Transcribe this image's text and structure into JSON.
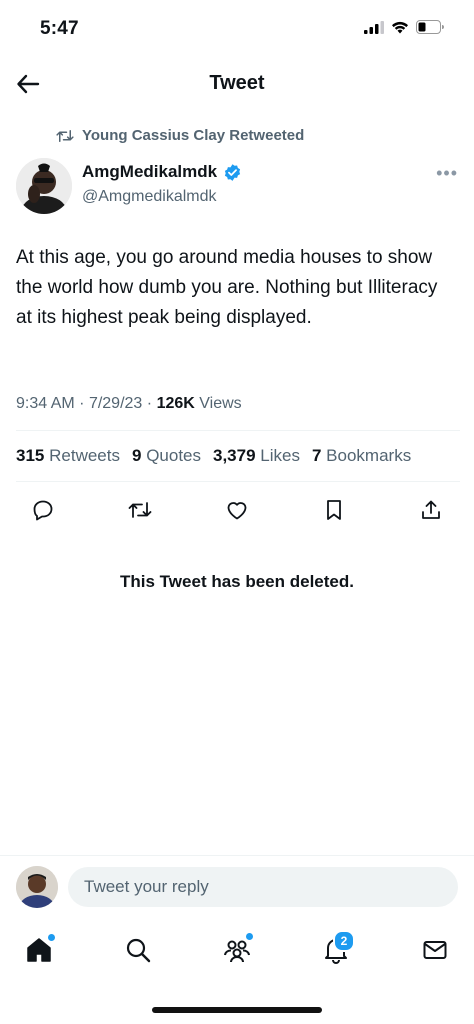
{
  "status_bar": {
    "time": "5:47"
  },
  "header": {
    "title": "Tweet"
  },
  "retweet": {
    "text": "Young Cassius Clay Retweeted"
  },
  "author": {
    "name": "AmgMedikalmdk",
    "handle": "@Amgmedikalmdk",
    "verified": true,
    "verified_color": "#1d9bf0"
  },
  "tweet": {
    "text": "At this age, you go around media houses to show the world how dumb you are. Nothing but Illiteracy at its highest peak being displayed.",
    "time": "9:34 AM",
    "date": "7/29/23",
    "views_count": "126K",
    "views_label": "Views"
  },
  "stats": {
    "retweets_count": "315",
    "retweets_label": "Retweets",
    "quotes_count": "9",
    "quotes_label": "Quotes",
    "likes_count": "3,379",
    "likes_label": "Likes",
    "bookmarks_count": "7",
    "bookmarks_label": "Bookmarks"
  },
  "actions": [
    "reply-icon",
    "retweet-icon",
    "like-icon",
    "bookmark-icon",
    "share-icon"
  ],
  "deleted_notice": "This Tweet has been deleted.",
  "reply": {
    "placeholder": "Tweet your reply"
  },
  "tabbar": {
    "items": [
      "home-icon",
      "search-icon",
      "communities-icon",
      "notifications-icon",
      "messages-icon"
    ],
    "notifications_badge": "2",
    "accent": "#1d9bf0"
  },
  "colors": {
    "text": "#0f1419",
    "secondary": "#536471",
    "divider": "#eff3f4"
  }
}
